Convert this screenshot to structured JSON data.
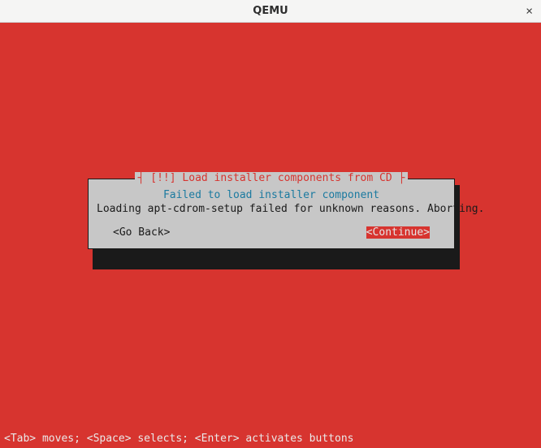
{
  "window": {
    "title": "QEMU",
    "close": "×"
  },
  "dialog": {
    "frame_title": "[!!] Load installer components from CD",
    "subtitle": "Failed to load installer component",
    "message": "Loading apt-cdrom-setup failed for unknown reasons. Aborting.",
    "go_back": "<Go Back>",
    "continue": "<Continue>"
  },
  "helpbar": "<Tab> moves; <Space> selects; <Enter> activates buttons"
}
